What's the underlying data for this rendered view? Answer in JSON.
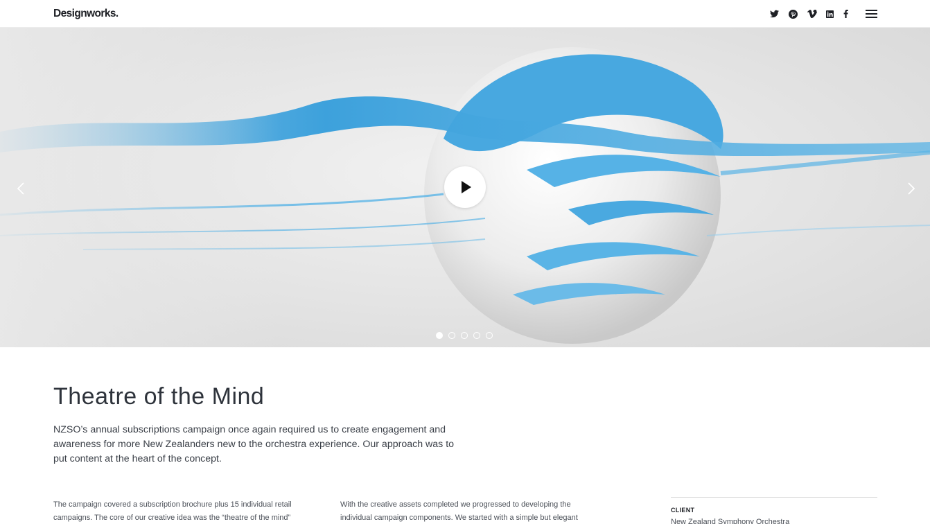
{
  "header": {
    "logo": "Designworks.",
    "social": [
      "twitter-icon",
      "pinterest-icon",
      "vimeo-icon",
      "linkedin-icon",
      "facebook-icon"
    ],
    "menu_icon": "hamburger-menu-icon"
  },
  "hero": {
    "slides_total": 5,
    "active_slide": 1,
    "play_icon": "play-icon",
    "prev_icon": "chevron-left-icon",
    "next_icon": "chevron-right-icon",
    "accent_color": "#4aa9e0"
  },
  "project": {
    "title": "Theatre of the Mind",
    "intro": "NZSO’s annual subscriptions campaign once again required us to create engagement and awareness for more New Zealanders new to the orchestra experience. Our approach was to put content at the heart of the concept.",
    "body_col1": "The campaign covered a subscription brochure plus 15 individual retail campaigns. The core of our creative idea was the “theatre of the mind”",
    "body_col2": "With the creative assets completed we progressed to developing the individual campaign components. We started with a simple but elegant",
    "client_label": "CLIENT",
    "client_value": "New Zealand Symphony Orchestra"
  }
}
